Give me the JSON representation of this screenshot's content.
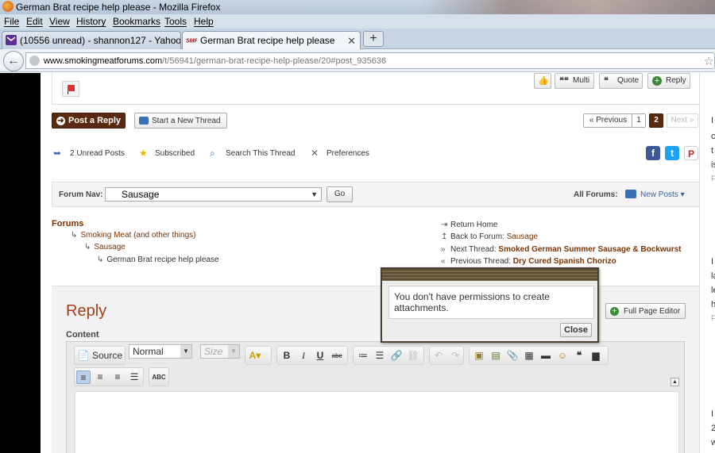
{
  "window": {
    "title": "German Brat recipe help please - Mozilla Firefox"
  },
  "menubar": [
    "File",
    "Edit",
    "View",
    "History",
    "Bookmarks",
    "Tools",
    "Help"
  ],
  "tabs": [
    {
      "label": "(10556 unread) - shannon127 - Yahoo...",
      "icon": "yahoo-mail-icon",
      "active": false
    },
    {
      "label": "German Brat recipe help please",
      "icon": "smf-icon",
      "active": true
    }
  ],
  "urlbar": {
    "domain": "www.smokingmeatforums.com",
    "path": "/t/56941/german-brat-recipe-help-please/20#post_935636"
  },
  "post_actions": {
    "multi": "Multi",
    "quote": "Quote",
    "reply": "Reply"
  },
  "thread_actions": {
    "post_reply": "Post a Reply",
    "start_thread": "Start a New Thread"
  },
  "pagination": {
    "previous": "« Previous",
    "pages": [
      "1",
      "2"
    ],
    "current": "2",
    "next": "Next »"
  },
  "tools": {
    "unread": "2 Unread Posts",
    "subscribed": "Subscribed",
    "search": "Search This Thread",
    "preferences": "Preferences"
  },
  "forum_nav": {
    "label": "Forum Nav:",
    "selected": "Sausage",
    "go": "Go",
    "all_forums": "All Forums:",
    "new_posts": "New Posts"
  },
  "breadcrumbs": {
    "root": "Forums",
    "level1": "Smoking Meat (and other things)",
    "level2": "Sausage",
    "level3": "German Brat recipe help please"
  },
  "related": {
    "return_home": "Return Home",
    "back_label": "Back to Forum:",
    "back_forum": "Sausage",
    "next_label": "Next Thread:",
    "next_thread": "Smoked German Summer Sausage & Bockwurst",
    "prev_label": "Previous Thread:",
    "prev_thread": "Dry Cured Spanish Chorizo"
  },
  "reply": {
    "title": "Reply",
    "content_label": "Content",
    "full_page_editor": "Full Page Editor"
  },
  "editor": {
    "source": "Source",
    "format": "Normal",
    "size": "Size"
  },
  "popup": {
    "message": "You don't have permissions to create attachments.",
    "close": "Close"
  },
  "right_column": [
    "I",
    "c",
    "t",
    "is",
    "F",
    "I",
    "la",
    "le",
    "h",
    "F",
    "I",
    "2",
    "w"
  ],
  "colors": {
    "brand_brown": "#5a2a10",
    "link_brown": "#7a3200",
    "title_rust": "#a0401a"
  }
}
